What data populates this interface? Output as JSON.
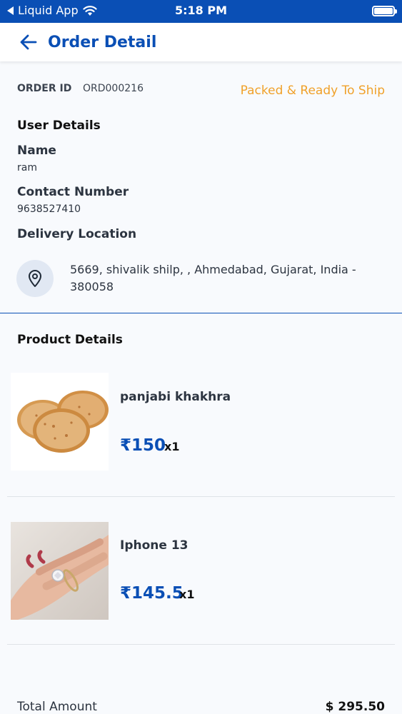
{
  "status_bar": {
    "carrier": "Liquid App",
    "time": "5:18 PM",
    "battery_level": 1.0
  },
  "nav": {
    "title": "Order Detail"
  },
  "order": {
    "id_label": "ORDER ID",
    "id_value": "ORD000216",
    "status": "Packed & Ready To Ship"
  },
  "user_details": {
    "title": "User Details",
    "name_label": "Name",
    "name_value": "ram",
    "contact_label": "Contact Number",
    "contact_value": "9638527410",
    "location_label": "Delivery Location",
    "address": "5669, shivalik shilp, , Ahmedabad, Gujarat, India - 380058"
  },
  "products": {
    "title": "Product Details",
    "items": [
      {
        "name": "panjabi khakhra",
        "price": "₹150",
        "qty": "x1"
      },
      {
        "name": "Iphone 13",
        "price": "₹145.5",
        "qty": "x1"
      }
    ]
  },
  "total": {
    "label": "Total Amount",
    "value": "$ 295.50"
  },
  "colors": {
    "accent": "#0a4fb5",
    "status": "#f0a12a",
    "background": "#f8fafd"
  }
}
